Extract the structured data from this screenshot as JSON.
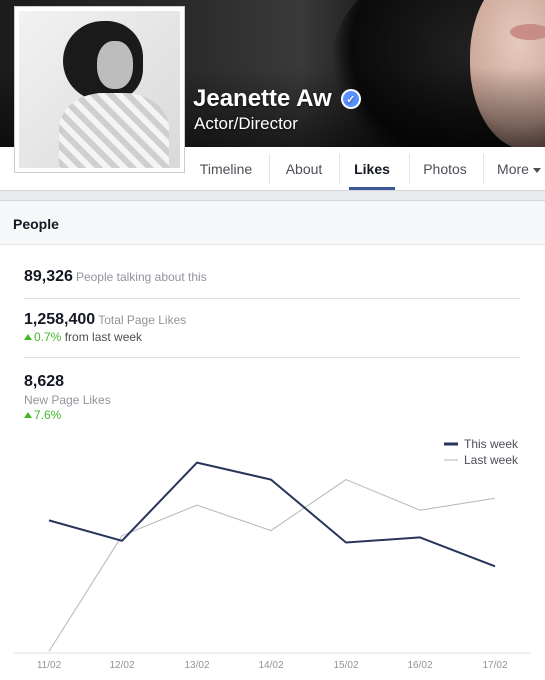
{
  "page": {
    "name": "Jeanette Aw",
    "category": "Actor/Director"
  },
  "tabs": [
    {
      "label": "Timeline"
    },
    {
      "label": "About"
    },
    {
      "label": "Likes"
    },
    {
      "label": "Photos"
    },
    {
      "label": "More"
    }
  ],
  "section": {
    "title": "People",
    "talking": {
      "value": "89,326",
      "label": "People talking about this"
    },
    "total": {
      "value": "1,258,400",
      "label": "Total Page Likes",
      "change": "0.7%",
      "change_suffix": "from last week"
    },
    "new_likes": {
      "value": "8,628",
      "label": "New Page Likes",
      "change": "7.6%"
    }
  },
  "colors": {
    "accent": "#3b5998",
    "positive": "#42b72a",
    "this_week_line": "#28355a",
    "last_week_line": "#b5b7ba"
  },
  "chart_data": {
    "type": "line",
    "x": [
      "11/02",
      "12/02",
      "13/02",
      "14/02",
      "15/02",
      "16/02",
      "17/02"
    ],
    "series": [
      {
        "name": "This week",
        "values": [
          8380,
          8260,
          8720,
          8620,
          8250,
          8280,
          8110
        ]
      },
      {
        "name": "Last week",
        "values": [
          7610,
          8290,
          8470,
          8320,
          8620,
          8440,
          8510
        ]
      }
    ],
    "legend": "top-right",
    "grid": false,
    "ylim": [
      7600,
      9000
    ]
  }
}
